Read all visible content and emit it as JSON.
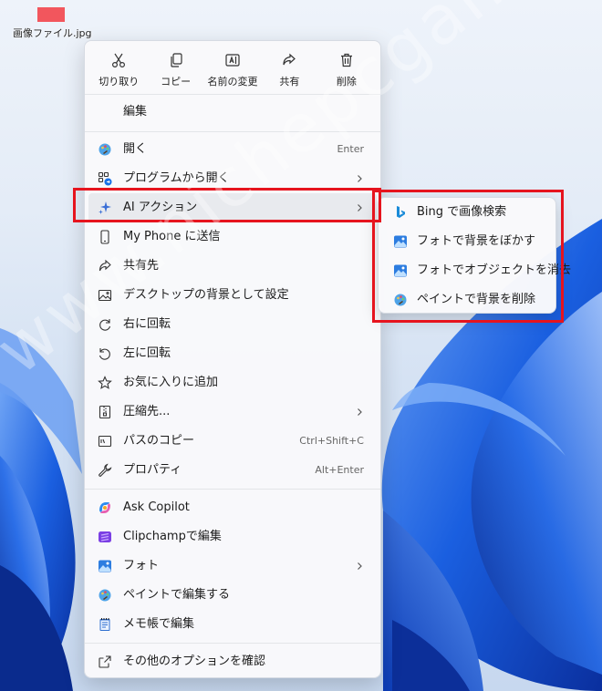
{
  "desktop": {
    "file_label": "画像ファイル.jpg",
    "watermark": "www.nichepcgamer.com"
  },
  "quick_actions": [
    {
      "label": "切り取り",
      "icon": "scissors-icon"
    },
    {
      "label": "コピー",
      "icon": "copy-icon"
    },
    {
      "label": "名前の変更",
      "icon": "rename-icon"
    },
    {
      "label": "共有",
      "icon": "share-icon"
    },
    {
      "label": "削除",
      "icon": "trash-icon"
    }
  ],
  "menu": {
    "edit_label": "編集",
    "items": [
      {
        "label": "開く",
        "accel": "Enter",
        "icon": "paint-palette-icon"
      },
      {
        "label": "プログラムから開く",
        "accel": "",
        "icon": "open-with-icon",
        "submenu": true
      },
      {
        "label": "AI アクション",
        "accel": "",
        "icon": "sparkle-icon",
        "submenu": true
      },
      {
        "label": "My Phone に送信",
        "accel": "",
        "icon": "phone-icon"
      },
      {
        "label": "共有先",
        "accel": "",
        "icon": "share-icon"
      },
      {
        "label": "デスクトップの背景として設定",
        "accel": "",
        "icon": "wallpaper-icon"
      },
      {
        "label": "右に回転",
        "accel": "",
        "icon": "rotate-right-icon"
      },
      {
        "label": "左に回転",
        "accel": "",
        "icon": "rotate-left-icon"
      },
      {
        "label": "お気に入りに追加",
        "accel": "",
        "icon": "star-icon"
      },
      {
        "label": "圧縮先...",
        "accel": "",
        "icon": "zip-icon",
        "submenu": true
      },
      {
        "label": "パスのコピー",
        "accel": "Ctrl+Shift+C",
        "icon": "copy-path-icon"
      },
      {
        "label": "プロパティ",
        "accel": "Alt+Enter",
        "icon": "wrench-icon"
      },
      {
        "label": "Ask Copilot",
        "accel": "",
        "icon": "copilot-icon"
      },
      {
        "label": "Clipchampで編集",
        "accel": "",
        "icon": "clipchamp-icon"
      },
      {
        "label": "フォト",
        "accel": "",
        "icon": "photos-icon",
        "submenu": true
      },
      {
        "label": "ペイントで編集する",
        "accel": "",
        "icon": "paint-palette-icon"
      },
      {
        "label": "メモ帳で編集",
        "accel": "",
        "icon": "notepad-icon"
      },
      {
        "label": "その他のオプションを確認",
        "accel": "",
        "icon": "more-options-icon"
      }
    ]
  },
  "ai_submenu": {
    "items": [
      {
        "label": "Bing で画像検索",
        "icon": "bing-icon"
      },
      {
        "label": "フォトで背景をぼかす",
        "icon": "photos-icon"
      },
      {
        "label": "フォトでオブジェクトを消去",
        "icon": "photos-icon"
      },
      {
        "label": "ペイントで背景を削除",
        "icon": "paint-palette-icon"
      }
    ]
  },
  "colors": {
    "highlight_border": "#e6141e",
    "wallpaper_blue": "#1452d6",
    "file_thumb": "#f2565d"
  }
}
